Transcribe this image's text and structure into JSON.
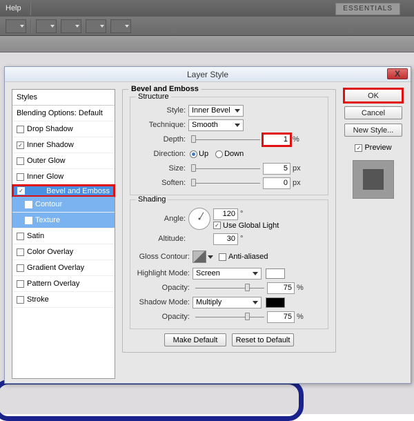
{
  "menubar": {
    "help": "Help"
  },
  "essentials": "ESSENTIALS",
  "dialog": {
    "title": "Layer Style",
    "close": "X",
    "styles": {
      "header": "Styles",
      "blending": "Blending Options: Default",
      "items": [
        {
          "label": "Drop Shadow",
          "checked": false
        },
        {
          "label": "Inner Shadow",
          "checked": true
        },
        {
          "label": "Outer Glow",
          "checked": false
        },
        {
          "label": "Inner Glow",
          "checked": false
        },
        {
          "label": "Bevel and Emboss",
          "checked": true,
          "selected": true,
          "highlight": true
        },
        {
          "label": "Contour",
          "checked": false,
          "sub": true
        },
        {
          "label": "Texture",
          "checked": false,
          "sub": true
        },
        {
          "label": "Satin",
          "checked": false
        },
        {
          "label": "Color Overlay",
          "checked": false
        },
        {
          "label": "Gradient Overlay",
          "checked": false
        },
        {
          "label": "Pattern Overlay",
          "checked": false
        },
        {
          "label": "Stroke",
          "checked": false
        }
      ]
    },
    "panel": {
      "title": "Bevel and Emboss",
      "structure": {
        "title": "Structure",
        "style_label": "Style:",
        "style_value": "Inner Bevel",
        "technique_label": "Technique:",
        "technique_value": "Smooth",
        "depth_label": "Depth:",
        "depth_value": "1",
        "depth_unit": "%",
        "depth_highlight": true,
        "direction_label": "Direction:",
        "up": "Up",
        "down": "Down",
        "size_label": "Size:",
        "size_value": "5",
        "size_unit": "px",
        "soften_label": "Soften:",
        "soften_value": "0",
        "soften_unit": "px"
      },
      "shading": {
        "title": "Shading",
        "angle_label": "Angle:",
        "angle_value": "120",
        "angle_unit": "°",
        "global": "Use Global Light",
        "altitude_label": "Altitude:",
        "altitude_value": "30",
        "altitude_unit": "°",
        "gloss_label": "Gloss Contour:",
        "aa": "Anti-aliased",
        "hmode_label": "Highlight Mode:",
        "hmode_value": "Screen",
        "hopacity_label": "Opacity:",
        "hopacity_value": "75",
        "hopacity_unit": "%",
        "smode_label": "Shadow Mode:",
        "smode_value": "Multiply",
        "sopacity_label": "Opacity:",
        "sopacity_value": "75",
        "sopacity_unit": "%"
      },
      "make_default": "Make Default",
      "reset_default": "Reset to Default"
    },
    "right": {
      "ok": "OK",
      "cancel": "Cancel",
      "newstyle": "New Style...",
      "preview": "Preview"
    }
  }
}
